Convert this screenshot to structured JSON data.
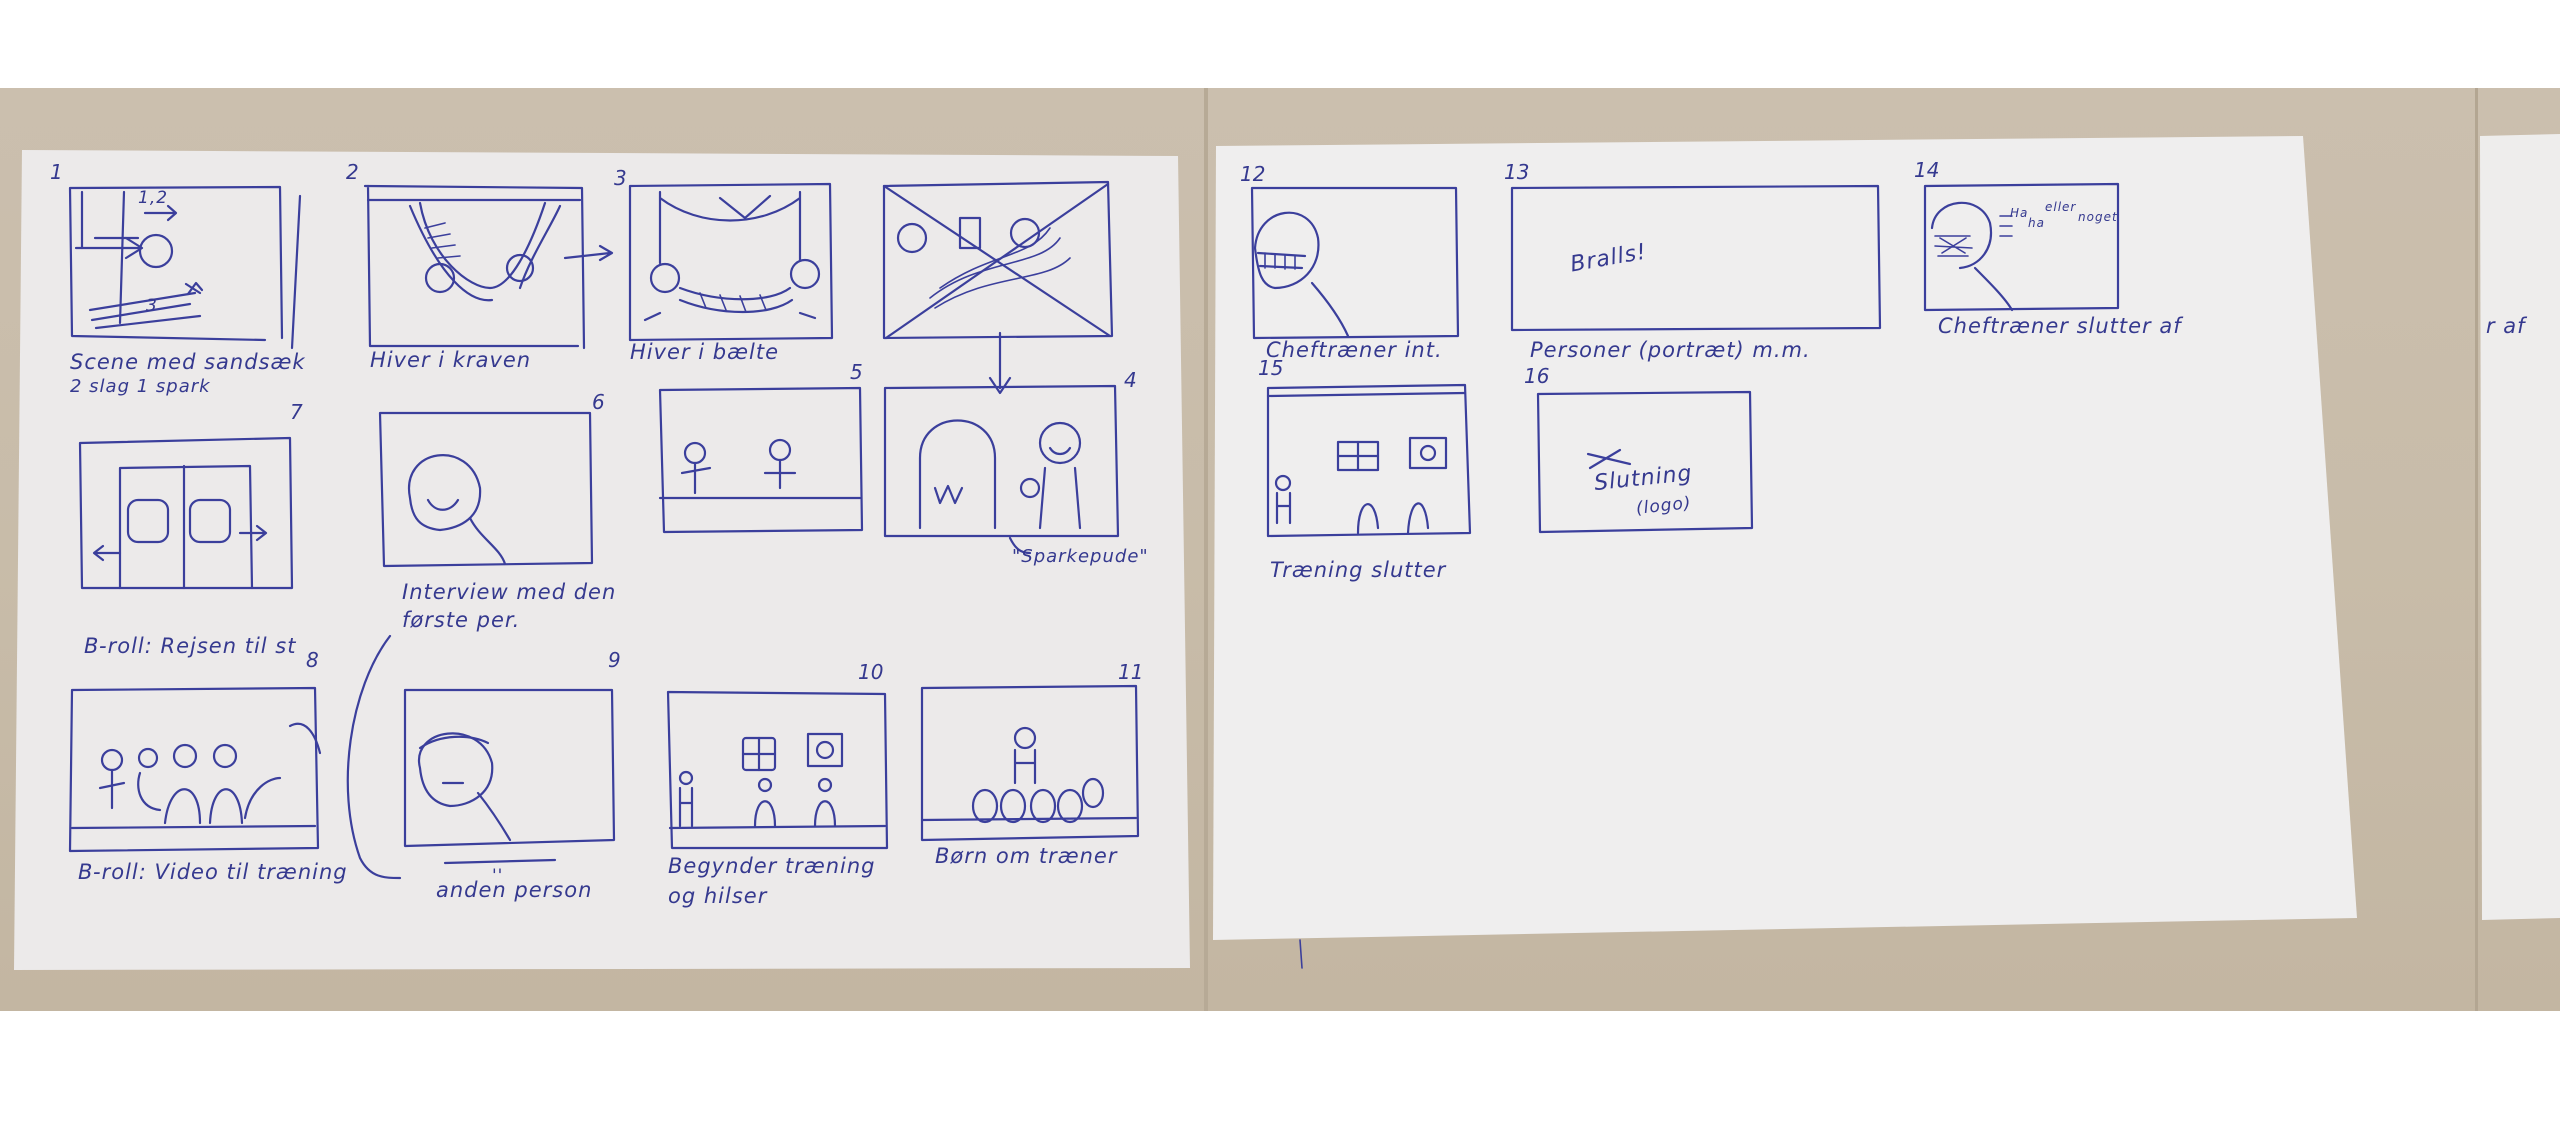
{
  "storyboard": {
    "panels": [
      {
        "number": "1",
        "caption_lines": [
          "Scene med sandsæk",
          "2 slag 1 spark"
        ],
        "marks": [
          "1,2",
          "3"
        ]
      },
      {
        "number": "2",
        "caption_lines": [
          "Hiver i kraven"
        ]
      },
      {
        "number": "3",
        "caption_lines": [
          "Hiver i bælte"
        ]
      },
      {
        "number": "4",
        "caption_lines": [
          "\"Sparkepude\""
        ]
      },
      {
        "number": "5",
        "caption_lines": []
      },
      {
        "number": "6",
        "caption_lines": [
          "Interview med den",
          "første per."
        ]
      },
      {
        "number": "7",
        "caption_lines": [
          "B-roll: Rejsen til st"
        ]
      },
      {
        "number": "8",
        "caption_lines": [
          "B-roll: Video til træning"
        ]
      },
      {
        "number": "9",
        "caption_lines": [
          "anden person"
        ],
        "marks": [
          "''"
        ]
      },
      {
        "number": "10",
        "caption_lines": [
          "Begynder træning",
          "og hilser"
        ]
      },
      {
        "number": "11",
        "caption_lines": [
          "Børn om træner"
        ]
      },
      {
        "number": "12",
        "caption_lines": [
          "Cheftræner int."
        ]
      },
      {
        "number": "13",
        "caption_lines": [
          "Personer (portræt) m.m."
        ],
        "inside_text": "Bralls!"
      },
      {
        "number": "14",
        "caption_lines": [
          "Cheftræner slutter af"
        ],
        "inside_text": [
          "Ha",
          "ha",
          "eller",
          "noget"
        ]
      },
      {
        "number": "15",
        "caption_lines": [
          "Træning slutter"
        ]
      },
      {
        "number": "16",
        "caption_lines": [],
        "inside_text": [
          "Slutning",
          "(logo)"
        ]
      }
    ],
    "cut_off_caption": "r af"
  },
  "colors": {
    "ink": "#3b3f9c",
    "paper": "#efeeee",
    "wall": "#c8bca9",
    "background": "#ffffff"
  }
}
